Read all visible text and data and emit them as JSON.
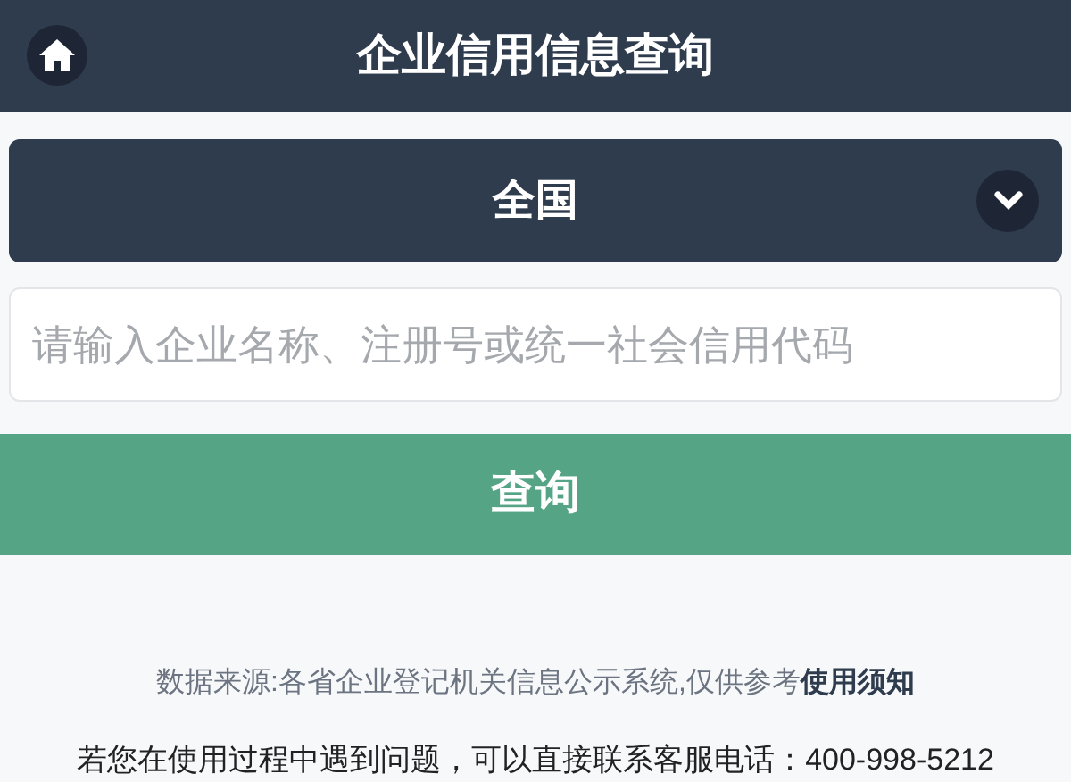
{
  "header": {
    "title": "企业信用信息查询"
  },
  "region_select": {
    "value": "全国"
  },
  "search": {
    "placeholder": "请输入企业名称、注册号或统一社会信用代码"
  },
  "search_button": {
    "label": "查询"
  },
  "footer": {
    "source": "数据来源:各省企业登记机关信息公示系统,仅供参考",
    "link": "使用须知",
    "contact": "若您在使用过程中遇到问题，可以直接联系客服电话：400-998-5212"
  }
}
